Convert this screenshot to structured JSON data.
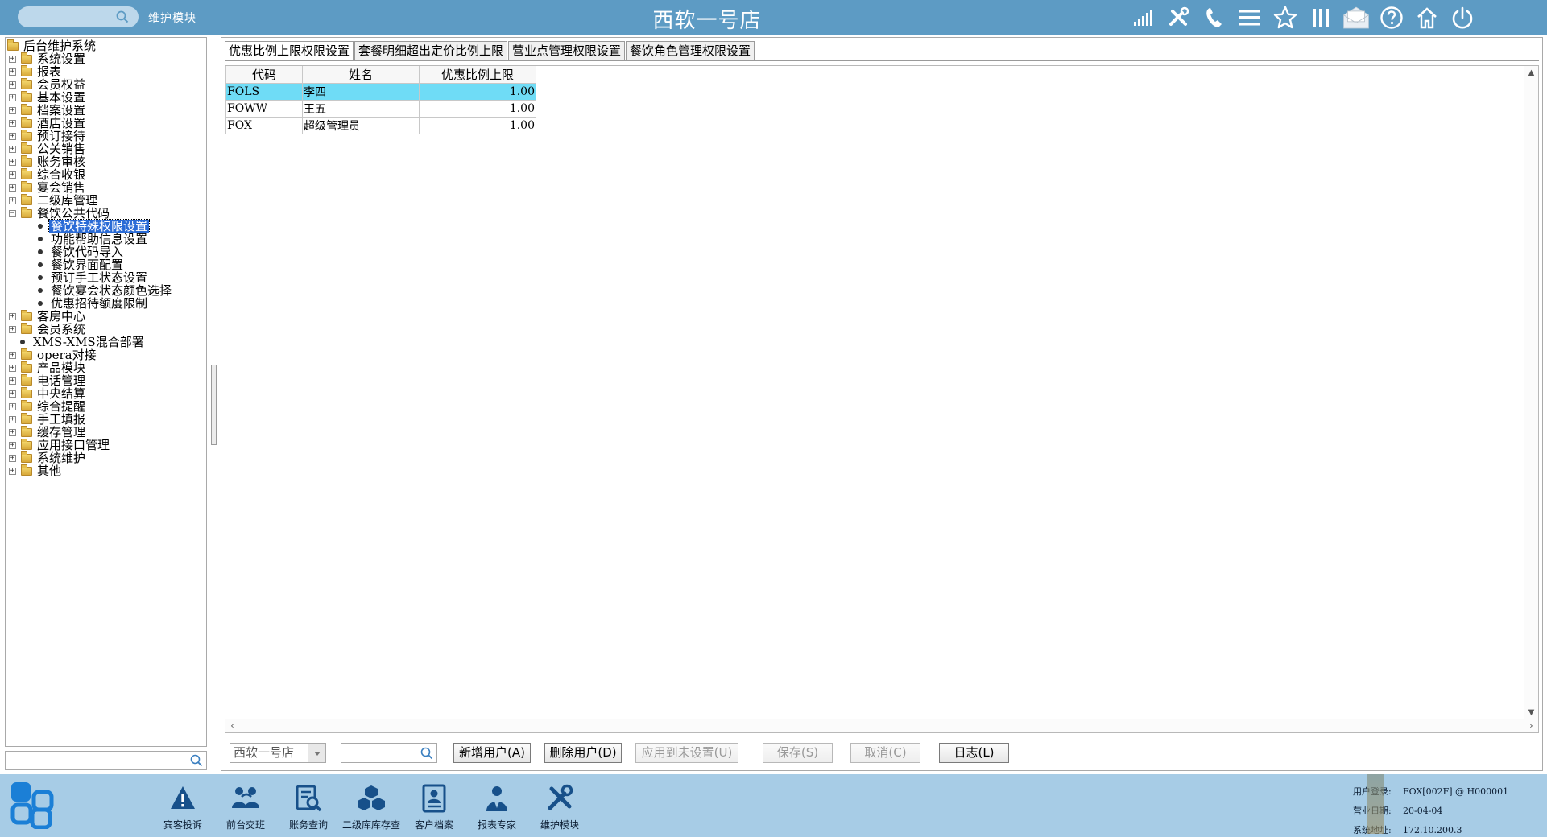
{
  "header": {
    "title": "西软一号店",
    "module": "维护模块",
    "icons": [
      "signal-icon",
      "tools-icon",
      "phone-icon",
      "menu-icon",
      "star-icon",
      "columns-icon",
      "mail-icon",
      "help-icon",
      "home-icon",
      "power-icon"
    ]
  },
  "tree": {
    "root": "后台维护系统",
    "items": [
      {
        "label": "系统设置",
        "type": "folder"
      },
      {
        "label": "报表",
        "type": "folder"
      },
      {
        "label": "会员权益",
        "type": "folder"
      },
      {
        "label": "基本设置",
        "type": "folder"
      },
      {
        "label": "档案设置",
        "type": "folder"
      },
      {
        "label": "酒店设置",
        "type": "folder"
      },
      {
        "label": "预订接待",
        "type": "folder"
      },
      {
        "label": "公关销售",
        "type": "folder"
      },
      {
        "label": "账务审核",
        "type": "folder"
      },
      {
        "label": "综合收银",
        "type": "folder"
      },
      {
        "label": "宴会销售",
        "type": "folder"
      },
      {
        "label": "二级库管理",
        "type": "folder"
      },
      {
        "label": "餐饮公共代码",
        "type": "folder-open"
      },
      {
        "label": "餐饮特殊权限设置",
        "type": "leaf",
        "selected": true
      },
      {
        "label": "功能帮助信息设置",
        "type": "leaf"
      },
      {
        "label": "餐饮代码导入",
        "type": "leaf"
      },
      {
        "label": "餐饮界面配置",
        "type": "leaf"
      },
      {
        "label": "预订手工状态设置",
        "type": "leaf"
      },
      {
        "label": "餐饮宴会状态颜色选择",
        "type": "leaf"
      },
      {
        "label": "优惠招待额度限制",
        "type": "leaf"
      },
      {
        "label": "客房中心",
        "type": "folder"
      },
      {
        "label": "会员系统",
        "type": "folder"
      },
      {
        "label": "XMS-XMS混合部署",
        "type": "root-leaf"
      },
      {
        "label": "opera对接",
        "type": "folder"
      },
      {
        "label": "产品模块",
        "type": "folder"
      },
      {
        "label": "电话管理",
        "type": "folder"
      },
      {
        "label": "中央结算",
        "type": "folder"
      },
      {
        "label": "综合提醒",
        "type": "folder"
      },
      {
        "label": "手工填报",
        "type": "folder"
      },
      {
        "label": "缓存管理",
        "type": "folder"
      },
      {
        "label": "应用接口管理",
        "type": "folder"
      },
      {
        "label": "系统维护",
        "type": "folder"
      },
      {
        "label": "其他",
        "type": "folder"
      }
    ]
  },
  "tabs": [
    {
      "label": "优惠比例上限权限设置",
      "active": true
    },
    {
      "label": "套餐明细超出定价比例上限",
      "active": false
    },
    {
      "label": "营业点管理权限设置",
      "active": false
    },
    {
      "label": "餐饮角色管理权限设置",
      "active": false
    }
  ],
  "grid": {
    "columns": [
      "代码",
      "姓名",
      "优惠比例上限"
    ],
    "rows": [
      {
        "code": "FOLS",
        "name": "李四",
        "limit": "1.00",
        "selected": true
      },
      {
        "code": "FOWW",
        "name": "王五",
        "limit": "1.00",
        "selected": false
      },
      {
        "code": "FOX",
        "name": "超级管理员",
        "limit": "1.00",
        "selected": false
      }
    ]
  },
  "toolbar": {
    "hotel_select": "西软一号店",
    "search_value": "",
    "buttons": [
      {
        "label": "新增用户(A)",
        "enabled": true
      },
      {
        "label": "删除用户(D)",
        "enabled": true
      },
      {
        "label": "应用到未设置(U)",
        "enabled": false
      },
      {
        "label": "保存(S)",
        "enabled": false
      },
      {
        "label": "取消(C)",
        "enabled": false
      },
      {
        "label": "日志(L)",
        "enabled": true
      }
    ]
  },
  "dock": [
    {
      "label": "宾客投诉",
      "icon": "warning-icon"
    },
    {
      "label": "前台交班",
      "icon": "handover-icon"
    },
    {
      "label": "账务查询",
      "icon": "account-query-icon"
    },
    {
      "label": "二级库库存查",
      "icon": "inventory-icon"
    },
    {
      "label": "客户档案",
      "icon": "customer-file-icon"
    },
    {
      "label": "报表专家",
      "icon": "report-expert-icon"
    },
    {
      "label": "维护模块",
      "icon": "maintenance-icon"
    }
  ],
  "status": {
    "user_label": "用户登录:",
    "user_value": "FOX[002F] @ H000001",
    "date_label": "营业日期:",
    "date_value": "20-04-04",
    "addr_label": "系统地址:",
    "addr_value": "172.10.200.3"
  },
  "colors": {
    "titlebar": "#5d9bc4",
    "bottombar": "#a7cce6",
    "row_selected": "#6fdcf6",
    "tree_selected": "#2a6bd6",
    "icon_dark": "#17508a"
  }
}
